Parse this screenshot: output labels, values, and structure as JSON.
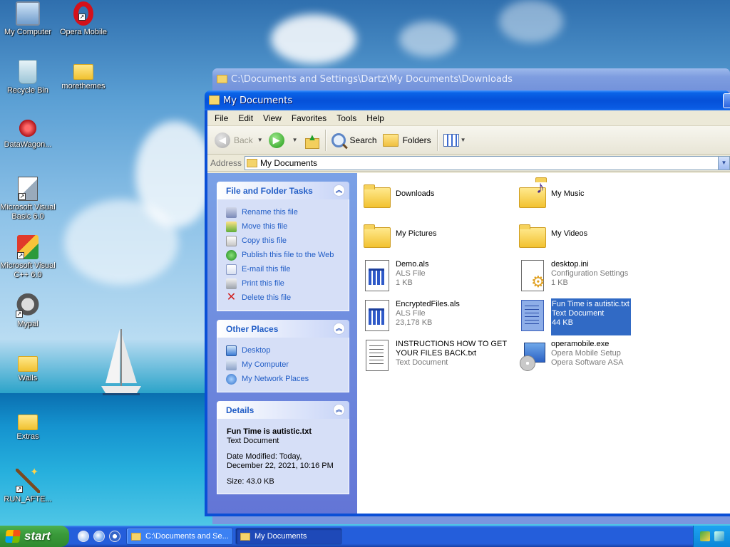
{
  "desktop": {
    "icons": [
      {
        "label": "My Computer"
      },
      {
        "label": "Opera Mobile"
      },
      {
        "label": "Recycle Bin"
      },
      {
        "label": "morethemes"
      },
      {
        "label": "DataWagon..."
      },
      {
        "label": "Microsoft Visual Basic 6.0"
      },
      {
        "label": "Microsoft Visual C++ 6.0"
      },
      {
        "label": "Mypal"
      },
      {
        "label": "Walls"
      },
      {
        "label": "Extras"
      },
      {
        "label": "RUN_AFTE..."
      }
    ]
  },
  "back_window": {
    "title": "C:\\Documents and Settings\\Dartz\\My Documents\\Downloads"
  },
  "window": {
    "title": "My Documents",
    "menu": [
      "File",
      "Edit",
      "View",
      "Favorites",
      "Tools",
      "Help"
    ],
    "toolbar": {
      "back": "Back",
      "search": "Search",
      "folders": "Folders"
    },
    "address": {
      "label": "Address",
      "value": "My Documents"
    },
    "tasks_panel": {
      "title": "File and Folder Tasks",
      "items": [
        "Rename this file",
        "Move this file",
        "Copy this file",
        "Publish this file to the Web",
        "E-mail this file",
        "Print this file",
        "Delete this file"
      ]
    },
    "places_panel": {
      "title": "Other Places",
      "items": [
        "Desktop",
        "My Computer",
        "My Network Places"
      ]
    },
    "details_panel": {
      "title": "Details",
      "name": "Fun Time is autistic.txt",
      "type": "Text Document",
      "modified_line1": "Date Modified: Today,",
      "modified_line2": "December 22, 2021, 10:16 PM",
      "size": "Size: 43.0 KB"
    },
    "files": [
      {
        "name": "Downloads",
        "l2": "",
        "l3": ""
      },
      {
        "name": "My Music",
        "l2": "",
        "l3": ""
      },
      {
        "name": "My Pictures",
        "l2": "",
        "l3": ""
      },
      {
        "name": "My Videos",
        "l2": "",
        "l3": ""
      },
      {
        "name": "Demo.als",
        "l2": "ALS File",
        "l3": "1 KB"
      },
      {
        "name": "desktop.ini",
        "l2": "Configuration Settings",
        "l3": "1 KB"
      },
      {
        "name": "EncryptedFiles.als",
        "l2": "ALS File",
        "l3": "23,178 KB"
      },
      {
        "name": "Fun Time is autistic.txt",
        "l2": "Text Document",
        "l3": "44 KB"
      },
      {
        "name": "INSTRUCTIONS HOW TO GET",
        "name2": "YOUR FILES BACK.txt",
        "l2": "Text Document",
        "l3": ""
      },
      {
        "name": "operamobile.exe",
        "l2": "Opera Mobile Setup",
        "l3": "Opera Software ASA"
      }
    ]
  },
  "taskbar": {
    "start": "start",
    "buttons": [
      "C:\\Documents and Se...",
      "My Documents"
    ]
  }
}
